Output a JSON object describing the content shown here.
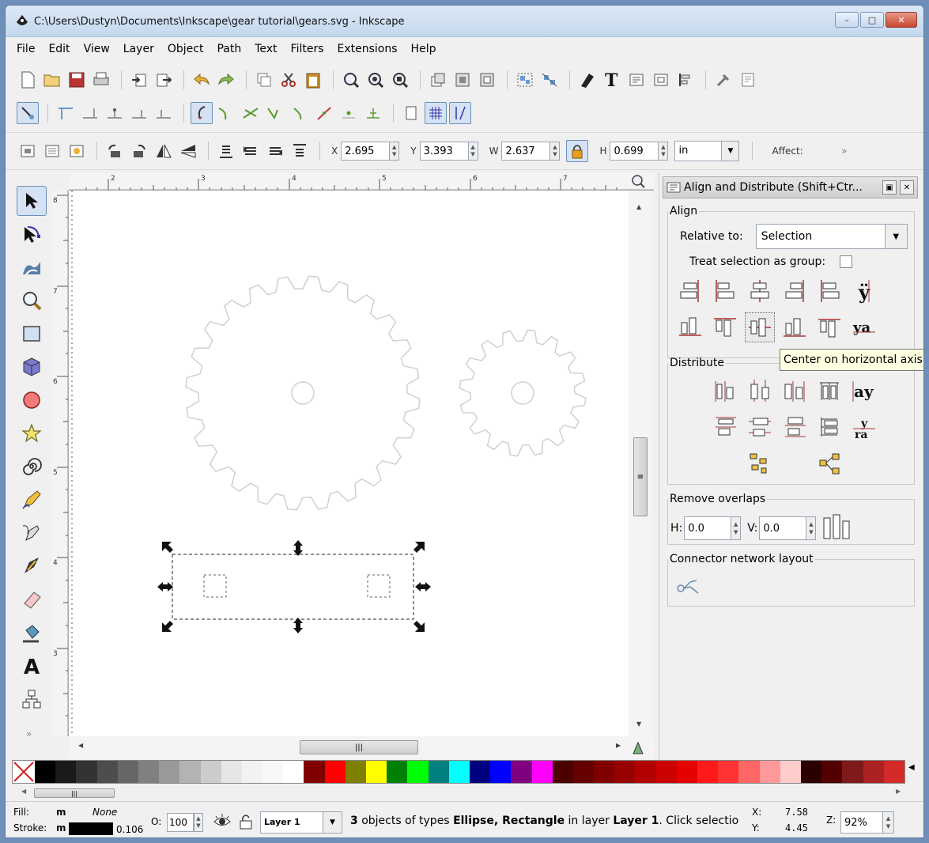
{
  "window": {
    "title": "C:\\Users\\Dustyn\\Documents\\Inkscape\\gear tutorial\\gears.svg - Inkscape",
    "minimize": "–",
    "maximize": "□",
    "close": "✕"
  },
  "menu": [
    {
      "label": "File"
    },
    {
      "label": "Edit"
    },
    {
      "label": "View"
    },
    {
      "label": "Layer"
    },
    {
      "label": "Object"
    },
    {
      "label": "Path"
    },
    {
      "label": "Text"
    },
    {
      "label": "Filters"
    },
    {
      "label": "Extensions"
    },
    {
      "label": "Help"
    }
  ],
  "selectbar": {
    "x_label": "X",
    "x_value": "2.695",
    "y_label": "Y",
    "y_value": "3.393",
    "w_label": "W",
    "w_value": "2.637",
    "h_label": "H",
    "h_value": "0.699",
    "unit": "in",
    "affect_label": "Affect:",
    "more": "»"
  },
  "rulers": {
    "h_ticks": [
      "2",
      "3",
      "4",
      "5",
      "6",
      "7"
    ],
    "v_ticks": [
      "8",
      "7",
      "6",
      "5",
      "4",
      "3"
    ]
  },
  "dock": {
    "title": "Align and Distribute (Shift+Ctr...",
    "align": {
      "legend": "Align",
      "relative_label": "Relative to:",
      "relative_value": "Selection",
      "treat_label": "Treat selection as group:"
    },
    "tooltip": "Center on horizontal axis",
    "distribute": {
      "legend": "Distribute"
    },
    "remove_overlaps": {
      "legend": "Remove overlaps",
      "h_label": "H:",
      "h_value": "0.0",
      "v_label": "V:",
      "v_value": "0.0"
    },
    "connector": {
      "legend": "Connector network layout"
    }
  },
  "palette": {
    "colors": [
      "#000000",
      "#1a1a1a",
      "#333333",
      "#4d4d4d",
      "#666666",
      "#808080",
      "#999999",
      "#b3b3b3",
      "#cccccc",
      "#e6e6e6",
      "#f2f2f2",
      "#f8f8f8",
      "#ffffff",
      "#800000",
      "#ff0000",
      "#808000",
      "#ffff00",
      "#008000",
      "#00ff00",
      "#008080",
      "#00ffff",
      "#000080",
      "#0000ff",
      "#800080",
      "#ff00ff",
      "#4d0000",
      "#660000",
      "#800000",
      "#990000",
      "#b30000",
      "#cc0000",
      "#e60000",
      "#ff1a1a",
      "#ff3333",
      "#ff6666",
      "#ff9999",
      "#ffcccc",
      "#2b0000",
      "#550000",
      "#801a1a",
      "#aa2222",
      "#d42a2a"
    ]
  },
  "status": {
    "fill_label": "Fill:",
    "fill_m": "m",
    "fill_value": "None",
    "stroke_label": "Stroke:",
    "stroke_m": "m",
    "stroke_width": "0.106",
    "opacity_label": "O:",
    "opacity_value": "100",
    "layer": "Layer 1",
    "message_count": "3",
    "message_a": " objects of types ",
    "message_types": "Ellipse, Rectangle",
    "message_b": " in layer ",
    "message_layer": "Layer 1",
    "message_c": ". Click selectio",
    "x_label": "X:",
    "x_value": "7.58",
    "y_label": "Y:",
    "y_value": "4.45",
    "z_label": "Z:",
    "zoom": "92%"
  }
}
